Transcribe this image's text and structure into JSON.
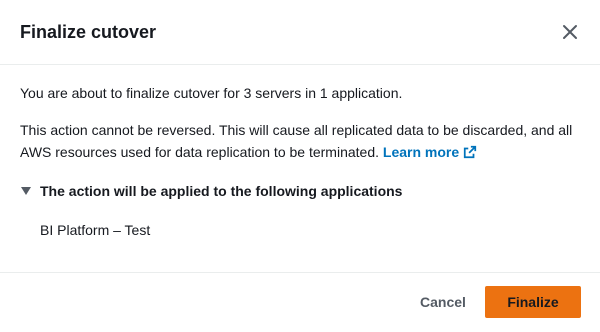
{
  "dialog": {
    "title": "Finalize cutover",
    "close_icon": "close-icon"
  },
  "body": {
    "summary": "You are about to finalize cutover for 3 servers in 1 application.",
    "warning": "This action cannot be reversed. This will cause all replicated data to be discarded, and all AWS resources used for data replication to be terminated.",
    "learn_more_label": "Learn more",
    "learn_more_icon": "external-link-icon",
    "expander_label": "The action will be applied to the following applications",
    "expander_icon": "caret-down-icon",
    "applications": [
      "BI Platform – Test"
    ]
  },
  "footer": {
    "cancel_label": "Cancel",
    "finalize_label": "Finalize"
  },
  "colors": {
    "primary": "#ec7211",
    "link": "#0073bb",
    "text": "#16191f",
    "divider": "#eaeded"
  }
}
